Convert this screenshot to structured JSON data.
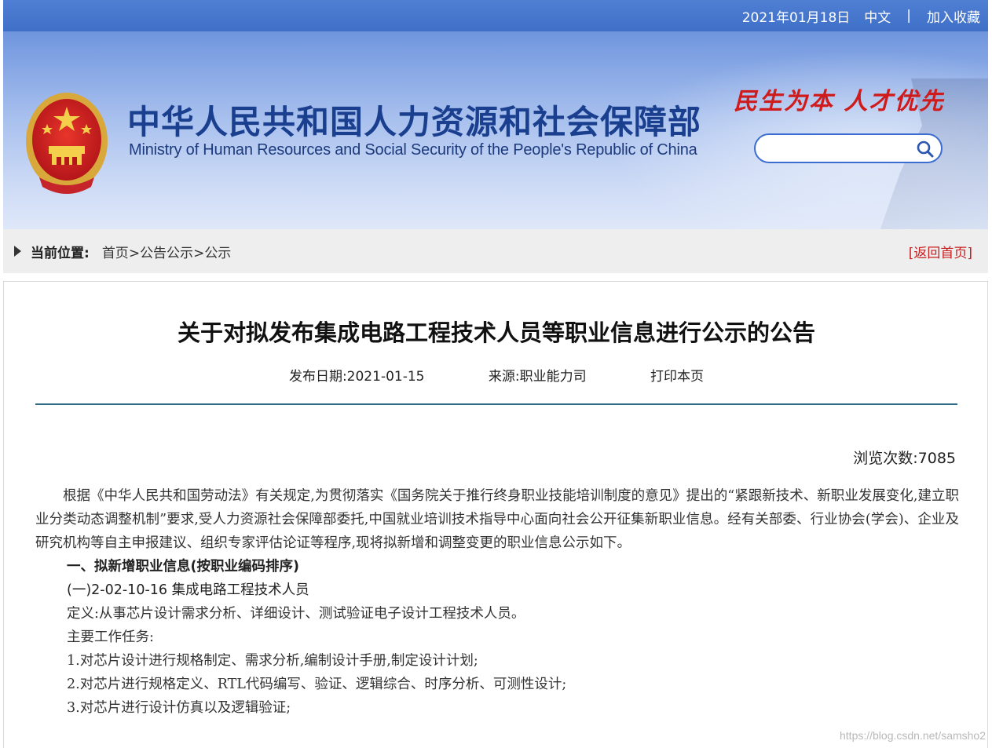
{
  "topbar": {
    "date": "2021年01月18日",
    "lang": "中文",
    "separator": "|",
    "favorite": "加入收藏"
  },
  "banner": {
    "title_cn": "中华人民共和国人力资源和社会保障部",
    "title_en": "Ministry of Human Resources and Social Security of the People's Republic of China",
    "slogan": "民生为本 人才优先",
    "search_placeholder": ""
  },
  "breadcrumb": {
    "label": "当前位置:",
    "items": [
      "首页",
      "公告公示",
      "公示"
    ],
    "sep": ">",
    "back": "[返回首页]"
  },
  "article": {
    "title": "关于对拟发布集成电路工程技术人员等职业信息进行公示的公告",
    "publish_date": "发布日期:2021-01-15",
    "source": "来源:职业能力司",
    "print": "打印本页",
    "views": "浏览次数:7085",
    "paragraph1": "根据《中华人民共和国劳动法》有关规定,为贯彻落实《国务院关于推行终身职业技能培训制度的意见》提出的“紧跟新技术、新职业发展变化,建立职业分类动态调整机制”要求,受人力资源社会保障部委托,中国就业培训技术指导中心面向社会公开征集新职业信息。经有关部委、行业协会(学会)、企业及研究机构等自主申报建议、组织专家评估论证等程序,现将拟新增和调整变更的职业信息公示如下。",
    "heading1": "一、拟新增职业信息(按职业编码排序)",
    "heading2": "(一)2-02-10-16 集成电路工程技术人员",
    "definition": "定义:从事芯片设计需求分析、详细设计、测试验证电子设计工程技术人员。",
    "tasks_label": "主要工作任务:",
    "tasks": [
      "1.对芯片设计进行规格制定、需求分析,编制设计手册,制定设计计划;",
      "2.对芯片进行规格定义、RTL代码编写、验证、逻辑综合、时序分析、可测性设计;",
      "3.对芯片进行设计仿真以及逻辑验证;"
    ]
  },
  "watermark": "https://blog.csdn.net/samsho2",
  "colors": {
    "topbar": "#4f7fd3",
    "title_blue": "#1a3f8f",
    "slogan_red": "#cf1b1b",
    "rule": "#2e6a86",
    "back_link": "#c81e1e"
  }
}
